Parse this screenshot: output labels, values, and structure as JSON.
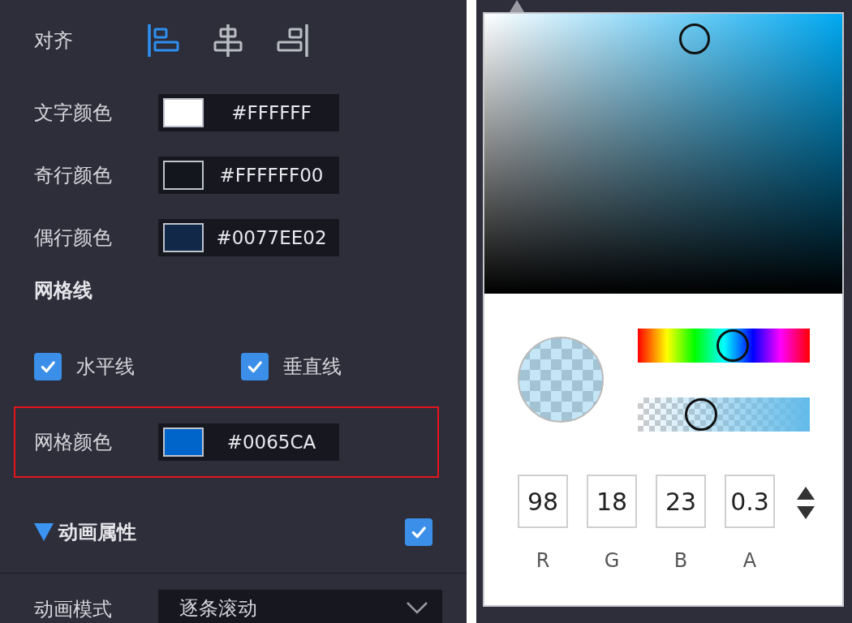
{
  "alignment": {
    "label": "对齐",
    "options": [
      {
        "kind": "left",
        "selected": true
      },
      {
        "kind": "center",
        "selected": false
      },
      {
        "kind": "right",
        "selected": false
      }
    ]
  },
  "color_rows": [
    {
      "label": "文字颜色",
      "color": "#ffffff",
      "value": "#FFFFFF"
    },
    {
      "label": "奇行颜色",
      "color": "#14161e",
      "value": "#FFFFFF00"
    },
    {
      "label": "偶行颜色",
      "color": "#112848",
      "value": "#0077EE02"
    }
  ],
  "grid_lines": {
    "title": "网格线",
    "options": [
      {
        "label": "水平线",
        "checked": true
      },
      {
        "label": "垂直线",
        "checked": true
      }
    ]
  },
  "grid_color": {
    "label": "网格颜色",
    "color": "#0065ca",
    "value": "#0065CA",
    "highlighted": true
  },
  "animation_section": {
    "title": "动画属性",
    "expanded": true,
    "enabled": true
  },
  "animation_mode": {
    "label": "动画模式",
    "value": "逐条滚动"
  },
  "color_picker": {
    "hue": {
      "level": 0.55
    },
    "alpha": {
      "level": 0.37
    },
    "channels": [
      {
        "label": "R",
        "value": "98"
      },
      {
        "label": "G",
        "value": "18"
      },
      {
        "label": "B",
        "value": "23"
      },
      {
        "label": "A",
        "value": "0.3"
      }
    ]
  }
}
